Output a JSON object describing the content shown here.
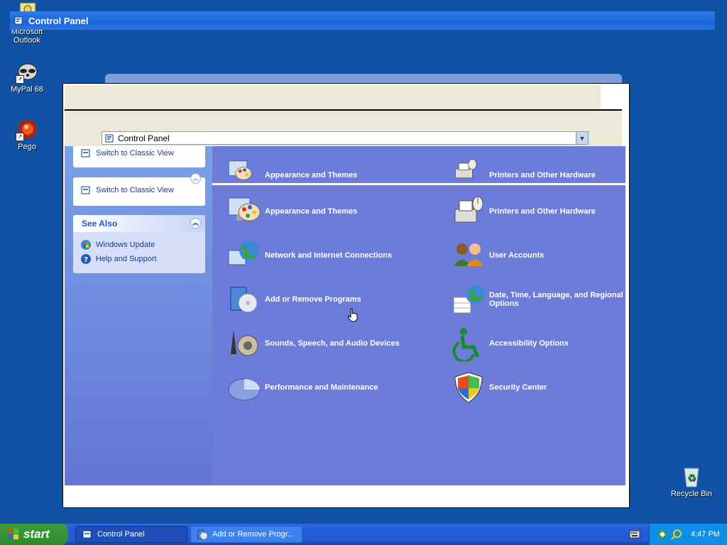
{
  "desktop": {
    "icons": [
      {
        "label": "Microsoft Outlook"
      },
      {
        "label": "MyPal 68"
      },
      {
        "label": "Pego"
      },
      {
        "label": "Recycle Bin"
      }
    ]
  },
  "top_title": "Control Panel",
  "address": {
    "value": "Control Panel"
  },
  "left_pane": {
    "switch_view_label": "Switch to Classic View",
    "see_also": {
      "title": "See Also",
      "items": [
        {
          "label": "Windows Update",
          "icon": "windows-update-icon"
        },
        {
          "label": "Help and Support",
          "icon": "help-icon"
        }
      ]
    }
  },
  "categories": {
    "ghost": [
      {
        "label": "Appearance and Themes",
        "icon": "appearance-icon"
      },
      {
        "label": "Printers and Other Hardware",
        "icon": "printer-icon"
      }
    ],
    "main": [
      {
        "label": "Appearance and Themes",
        "icon": "appearance-icon"
      },
      {
        "label": "Printers and Other Hardware",
        "icon": "printer-icon"
      },
      {
        "label": "Network and Internet Connections",
        "icon": "network-icon"
      },
      {
        "label": "User Accounts",
        "icon": "users-icon"
      },
      {
        "label": "Add or Remove Programs",
        "icon": "add-remove-icon"
      },
      {
        "label": "Date, Time, Language, and Regional Options",
        "icon": "date-time-icon"
      },
      {
        "label": "Sounds, Speech, and Audio Devices",
        "icon": "sound-icon"
      },
      {
        "label": "Accessibility Options",
        "icon": "accessibility-icon"
      },
      {
        "label": "Performance and Maintenance",
        "icon": "performance-icon"
      },
      {
        "label": "Security Center",
        "icon": "shield-icon"
      }
    ]
  },
  "taskbar": {
    "start_label": "start",
    "buttons": [
      {
        "label": "Control Panel"
      },
      {
        "label": "Add or Remove Progr..."
      }
    ],
    "clock": "4:47 PM"
  },
  "colors": {
    "desktop": "#1053a6",
    "category_pane": "#6d7bd9",
    "task_pane": "#7aa1e6",
    "taskbar": "#245edb",
    "start_button": "#3f9c3d"
  }
}
